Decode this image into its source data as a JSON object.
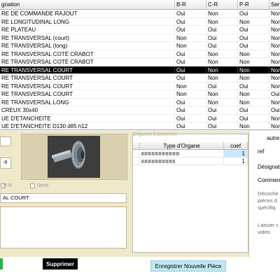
{
  "grid": {
    "columns": [
      "gnation",
      "B-R",
      "C-R",
      "P-R",
      "Seri"
    ],
    "rows": [
      {
        "designation": "RE DE COMMANDE RAJOUT",
        "br": "Oui",
        "cr": "Non",
        "pr": "Oui",
        "serie": "Non"
      },
      {
        "designation": "RE LONGITUDINAL LONG",
        "br": "Oui",
        "cr": "Non",
        "pr": "Non",
        "serie": "Non"
      },
      {
        "designation": "RE PLATEAU",
        "br": "Oui",
        "cr": "Oui",
        "pr": "Oui",
        "serie": "Non"
      },
      {
        "designation": "RE TRANSVERSAL (court)",
        "br": "Non",
        "cr": "Oui",
        "pr": "Oui",
        "serie": "Non"
      },
      {
        "designation": "RE TRANSVERSAL (long)",
        "br": "Non",
        "cr": "Oui",
        "pr": "Oui",
        "serie": "Non"
      },
      {
        "designation": "RE TRANSVERSAL COTÉ CRABOT",
        "br": "Oui",
        "cr": "Non",
        "pr": "Non",
        "serie": "Non"
      },
      {
        "designation": "RE TRANSVERSAL COTÉ CRABOT",
        "br": "Oui",
        "cr": "Non",
        "pr": "Non",
        "serie": "Non"
      },
      {
        "designation": "RE TRANSVERSAL COURT",
        "br": "Oui",
        "cr": "Non",
        "pr": "Non",
        "serie": "Non"
      },
      {
        "designation": "RE TRANSVERSAL COURT",
        "br": "Oui",
        "cr": "Non",
        "pr": "Non",
        "serie": "Non"
      },
      {
        "designation": "RE TRANSVERSAL COURT",
        "br": "Non",
        "cr": "Oui",
        "pr": "Oui",
        "serie": "Non"
      },
      {
        "designation": "RE TRANSVERSAL COURT",
        "br": "Non",
        "cr": "Non",
        "pr": "Non",
        "serie": "Oui"
      },
      {
        "designation": "RE TRANSVERSAL LONG",
        "br": "Oui",
        "cr": "Non",
        "pr": "Non",
        "serie": "Non"
      },
      {
        "designation": "CREUX 30x40",
        "br": "Oui",
        "cr": "Oui",
        "pr": "Oui",
        "serie": "Oui"
      },
      {
        "designation": "UE D'ETANCHEITE",
        "br": "Oui",
        "cr": "Oui",
        "pr": "Oui",
        "serie": "Non"
      },
      {
        "designation": "UE D'ETANCHEITE D130 d85 h12",
        "br": "Oui",
        "cr": "Oui",
        "pr": "Non",
        "serie": "Non"
      },
      {
        "designation": "UE EPAULE BLOCAGE ARBRE",
        "br": "Non",
        "cr": "Non",
        "pr": "Oui",
        "serie": "Non"
      }
    ],
    "selected_index": 7
  },
  "form": {
    "field_suffix": "-9",
    "checkbox_labels": [
      "P-R",
      "Serie"
    ],
    "name_value": "AL COURT",
    "notes_value": ""
  },
  "organe": {
    "caption": "Organes Concernés",
    "headers": [
      "Type d'Organe",
      "coef"
    ],
    "rows": [
      {
        "coef": "1",
        "selected": true
      },
      {
        "coef": "1",
        "selected": false
      }
    ]
  },
  "right": {
    "autre": "autre",
    "ref": "ref",
    "designation": "Désignat",
    "comment": "Commen",
    "help1": [
      "Décoche",
      "pièces d",
      "spécifiq"
    ],
    "help2": [
      "Laisser c",
      "vides."
    ]
  },
  "buttons": {
    "delete": "Supprimer",
    "save": "Enregistrer Nouvelle Pièce"
  },
  "colors": {
    "panel": "#efe8c9",
    "selected_row": "#000000",
    "save_button": "#bfe9f0",
    "green_button": "#27b34a"
  }
}
